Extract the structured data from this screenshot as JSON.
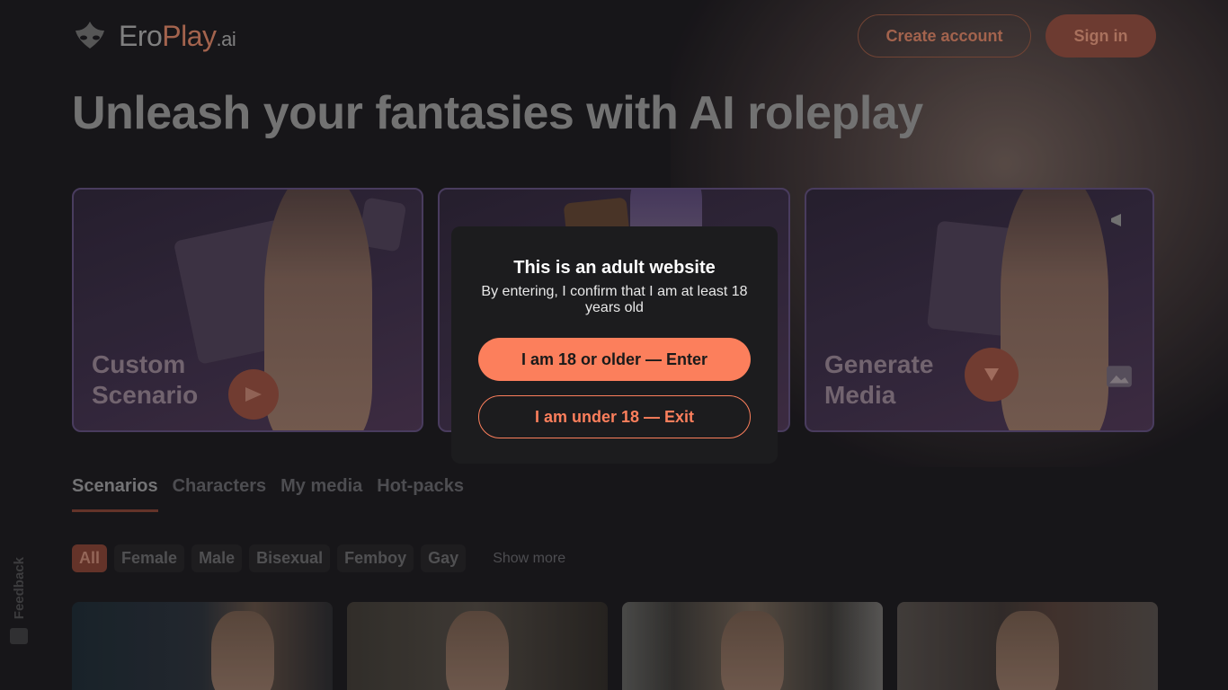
{
  "brand": {
    "logo_main": "Ero",
    "logo_accent": "Play",
    "logo_suffix": ".ai",
    "accent_color": "#fc7f5c"
  },
  "header": {
    "create_account_label": "Create account",
    "sign_in_label": "Sign in"
  },
  "hero": {
    "headline": "Unleash your fantasies with AI roleplay"
  },
  "feature_cards": [
    {
      "title": "Custom Scenario",
      "icon": "play-icon"
    },
    {
      "title": "",
      "icon": "chat-icon"
    },
    {
      "title": "Generate Media",
      "icon": "play-icon"
    }
  ],
  "tabs": [
    {
      "label": "Scenarios",
      "active": true
    },
    {
      "label": "Characters",
      "active": false
    },
    {
      "label": "My media",
      "active": false
    },
    {
      "label": "Hot-packs",
      "active": false
    }
  ],
  "filters": {
    "chips": [
      "All",
      "Female",
      "Male",
      "Bisexual",
      "Femboy",
      "Gay"
    ],
    "active": "All",
    "show_more_label": "Show more"
  },
  "feedback": {
    "label": "Feedback",
    "icon": "feedback-icon"
  },
  "age_gate": {
    "title": "This is an adult website",
    "subtitle": "By entering, I confirm that I am at least 18 years old",
    "enter_label": "I am 18 or older — Enter",
    "exit_label": "I am under 18 — Exit"
  }
}
